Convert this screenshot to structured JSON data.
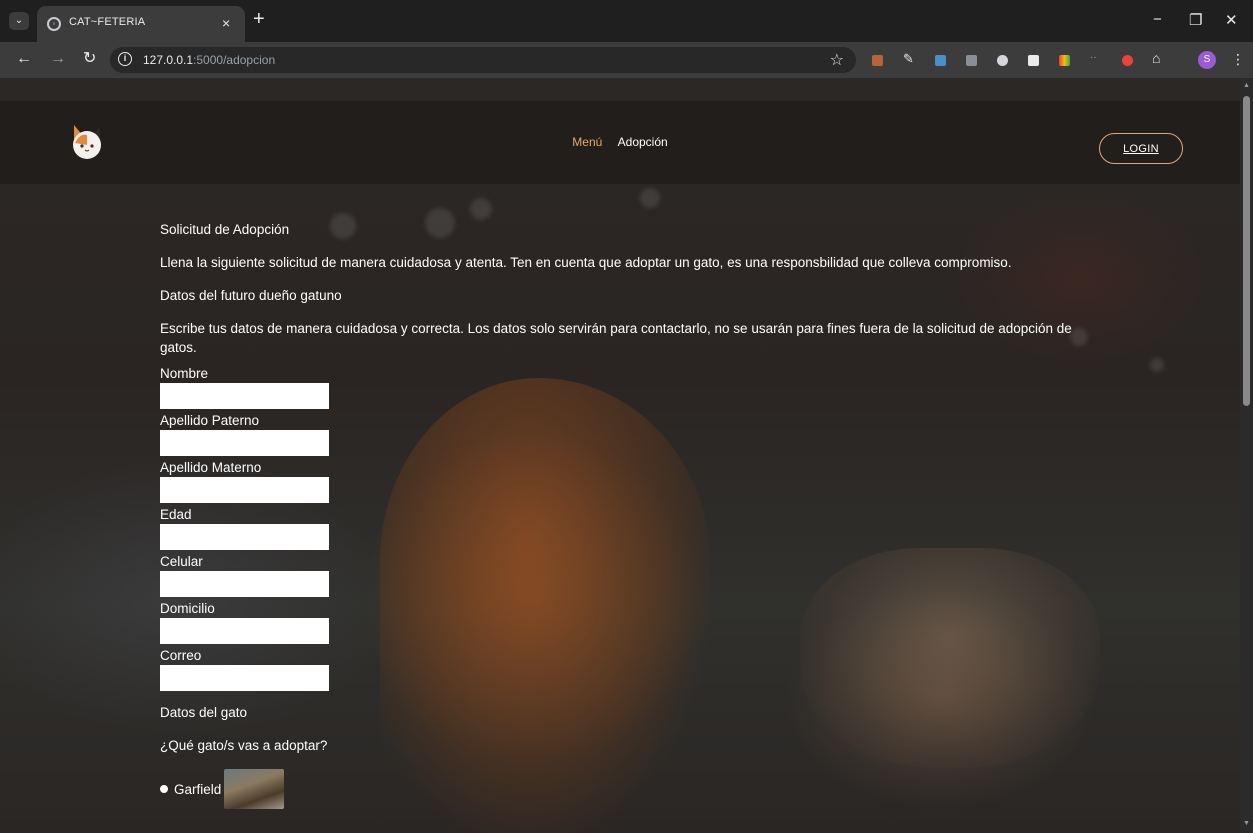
{
  "browser": {
    "tab_title": "CAT~FETERIA",
    "tab_close": "×",
    "new_tab": "+",
    "url_host": "127.0.0.1",
    "url_rest": ":5000/adopcion",
    "profile_initial": "S",
    "minimize": "−",
    "restore": "❐",
    "close": "✕"
  },
  "site": {
    "nav": {
      "menu": "Menú",
      "adopcion": "Adopción"
    },
    "login": "LOGIN",
    "colors": {
      "accent": "#e0a96d"
    }
  },
  "form": {
    "title": "Solicitud de Adopción",
    "intro": "Llena la siguiente solicitud de manera cuidadosa y atenta. Ten en cuenta que adoptar un gato, es una responsbilidad que colleva compromiso.",
    "owner_section": "Datos del futuro dueño gatuno",
    "owner_desc": "Escribe tus datos de manera cuidadosa y correcta. Los datos solo servirán para contactarlo, no se usarán para fines fuera de la solicitud de adopción de gatos.",
    "fields": {
      "nombre": "Nombre",
      "apellido_paterno": "Apellido Paterno",
      "apellido_materno": "Apellido Materno",
      "edad": "Edad",
      "celular": "Celular",
      "domicilio": "Domicilio",
      "correo": "Correo"
    },
    "cat_section": "Datos del gato",
    "cat_question": "¿Qué gato/s vas a adoptar?",
    "cat_options": [
      "Garfield"
    ]
  }
}
